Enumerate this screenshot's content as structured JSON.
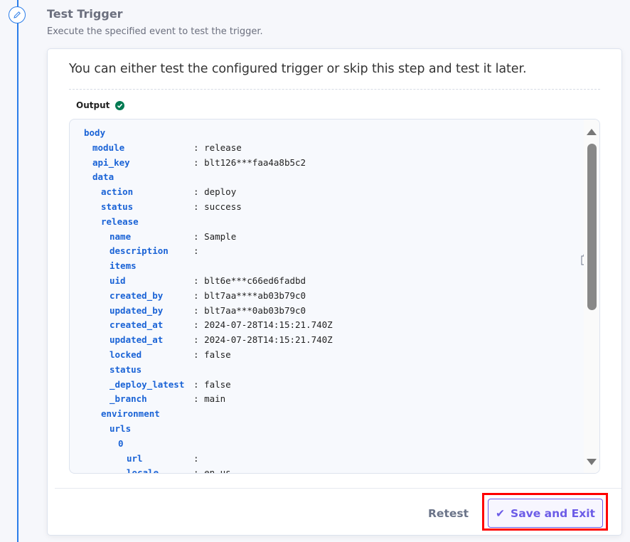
{
  "step": {
    "title": "Test Trigger",
    "subtitle": "Execute the specified event to test the trigger.",
    "icon": "pencil-icon"
  },
  "card": {
    "intro": "You can either test the configured trigger or skip this step and test it later.",
    "output_label": "Output",
    "output_status": "success",
    "colors": {
      "key": "#1a63d6",
      "success": "#007a52",
      "accent": "#6c5ce7"
    },
    "lines": [
      {
        "level": 0,
        "key": "body"
      },
      {
        "level": 1,
        "key": "module",
        "value": "release"
      },
      {
        "level": 1,
        "key": "api_key",
        "value": "blt126***faa4a8b5c2"
      },
      {
        "level": 1,
        "key": "data"
      },
      {
        "level": 2,
        "key": "action",
        "value": "deploy"
      },
      {
        "level": 2,
        "key": "status",
        "value": "success"
      },
      {
        "level": 2,
        "key": "release"
      },
      {
        "level": 3,
        "key": "name",
        "value": "Sample"
      },
      {
        "level": 3,
        "key": "description",
        "value": ""
      },
      {
        "level": 3,
        "key": "items"
      },
      {
        "level": 3,
        "key": "uid",
        "value": "blt6e***c66ed6fadbd"
      },
      {
        "level": 3,
        "key": "created_by",
        "value": "blt7aa****ab03b79c0"
      },
      {
        "level": 3,
        "key": "updated_by",
        "value": "blt7aa***0ab03b79c0"
      },
      {
        "level": 3,
        "key": "created_at",
        "value": "2024-07-28T14:15:21.740Z"
      },
      {
        "level": 3,
        "key": "updated_at",
        "value": "2024-07-28T14:15:21.740Z"
      },
      {
        "level": 3,
        "key": "locked",
        "value": "false"
      },
      {
        "level": 3,
        "key": "status"
      },
      {
        "level": 3,
        "key": "_deploy_latest",
        "value": "false"
      },
      {
        "level": 3,
        "key": "_branch",
        "value": "main"
      },
      {
        "level": 2,
        "key": "environment"
      },
      {
        "level": 3,
        "key": "urls"
      },
      {
        "level": 4,
        "key": "0"
      },
      {
        "level": 5,
        "key": "url",
        "value": ""
      },
      {
        "level": 5,
        "key": "locale",
        "value": "en-us"
      }
    ],
    "footer": {
      "retest_label": "Retest",
      "save_label": "Save and Exit"
    }
  }
}
